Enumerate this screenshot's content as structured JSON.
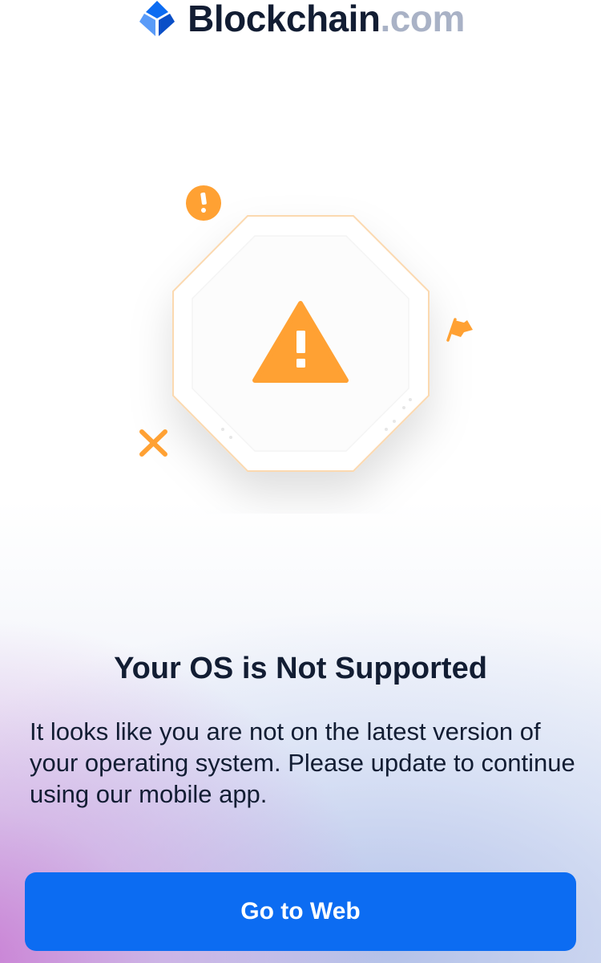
{
  "brand": {
    "name": "Blockchain",
    "domain": ".com",
    "icon": "blockchain-cube-logo"
  },
  "illustration": {
    "icon": "warning-octagon-icon",
    "decorations": [
      "exclamation-badge-icon",
      "flag-icon",
      "x-mark-icon"
    ]
  },
  "title": "Your OS is Not Supported",
  "message": "It looks like you are not on the latest version of your operating system. Please update to continue using our mobile app.",
  "primary_button": {
    "label": "Go to Web"
  },
  "colors": {
    "accent": "#0c6cf2",
    "warning": "#ffa133",
    "text": "#121d33",
    "domain_gray": "#a9b2c6"
  }
}
